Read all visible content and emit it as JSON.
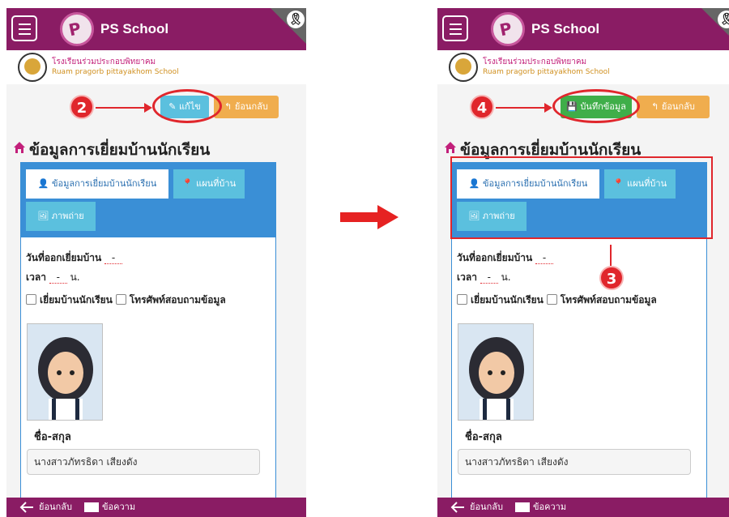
{
  "app": {
    "title": "PS School",
    "logo_text": "P"
  },
  "school": {
    "name_th": "โรงเรียนร่วมประกอบพิทยาคม",
    "name_en": "Ruam pragorb pittayakhom School"
  },
  "left_screen": {
    "action_button": "แก้ไข",
    "back_button": "ย้อนกลับ",
    "step_number": "2"
  },
  "right_screen": {
    "action_button": "บันทึกข้อมูล",
    "back_button": "ย้อนกลับ",
    "step_number": "4",
    "annotation_number": "3"
  },
  "page": {
    "heading": "ข้อมูลการเยี่ยมบ้านนักเรียน"
  },
  "tabs": [
    {
      "label": "ข้อมูลการเยี่ยมบ้านนักเรียน"
    },
    {
      "label": "แผนที่บ้าน"
    },
    {
      "label": "ภาพถ่าย"
    }
  ],
  "form": {
    "visit_date_label": "วันที่ออกเยี่ยมบ้าน",
    "visit_date_value": "-",
    "time_label": "เวลา",
    "time_value": "-",
    "time_unit": "น.",
    "checkbox_visit": "เยี่ยมบ้านนักเรียน",
    "checkbox_phone": "โทรศัพท์สอบถามข้อมูล",
    "name_label": "ชื่อ-สกุล",
    "name_value": "นางสาวภัทรธิดา เสียงดัง"
  },
  "bottom_nav": {
    "back": "ย้อนกลับ",
    "message": "ข้อความ"
  },
  "colors": {
    "topbar": "#8a1c64",
    "edit": "#5bc0de",
    "save": "#3fae49",
    "back": "#f0ad4e",
    "panel": "#3a8fd6",
    "annotation": "#e0262c"
  }
}
